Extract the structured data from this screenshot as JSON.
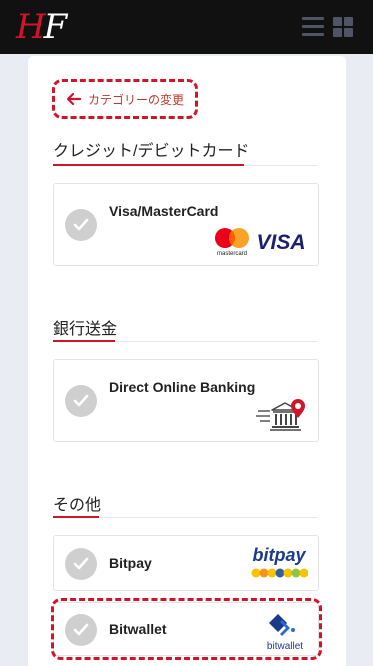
{
  "header": {
    "logo_h": "H",
    "logo_f": "F"
  },
  "back": {
    "label": "カテゴリーの変更"
  },
  "sections": {
    "cards": {
      "title": "クレジット/デビットカード"
    },
    "bank": {
      "title": "銀行送金"
    },
    "other": {
      "title": "その他"
    }
  },
  "methods": {
    "visa": {
      "label": "Visa/MasterCard",
      "mastercard_text": "mastercard",
      "visa_text": "VISA"
    },
    "bank": {
      "label": "Direct Online Banking"
    },
    "bitpay": {
      "label": "Bitpay",
      "logo_text": "bitpay"
    },
    "bitwallet": {
      "label": "Bitwallet",
      "logo_text": "bitwallet"
    }
  },
  "colors": {
    "accent": "#d0152a",
    "topbar": "#111111",
    "visa_blue": "#1a1f71",
    "bitpay_blue": "#1a3b8b"
  }
}
